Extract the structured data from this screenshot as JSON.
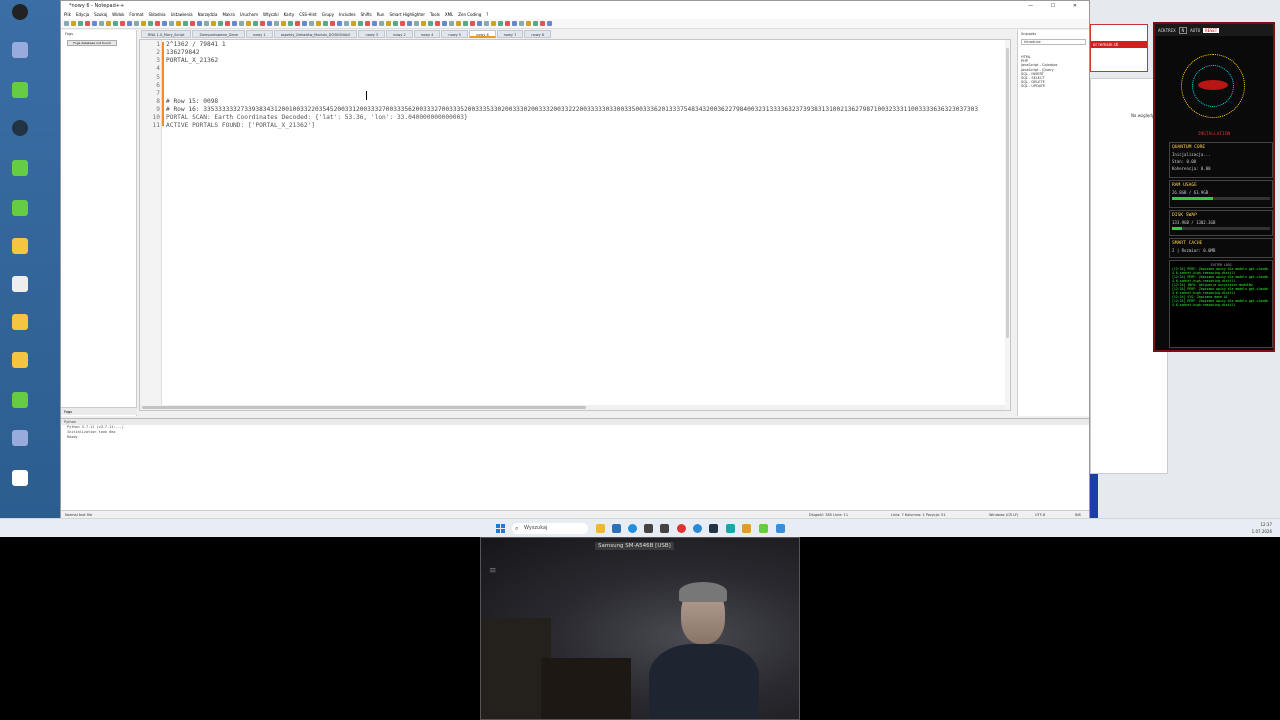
{
  "editor": {
    "title": "*nowy 6 - Notepad++",
    "window_controls": "— ☐ ✕",
    "menu": [
      "Plik",
      "Edycja",
      "Szukaj",
      "Widok",
      "Format",
      "Składnia",
      "Ustawienia",
      "Narzędzia",
      "Makra",
      "Uruchom",
      "Wtyczki",
      "Karty",
      "CSS-Hint",
      "Grupy",
      "Includes",
      "Shifts",
      "Run",
      "Smart Highlighter",
      "Tools",
      "XML",
      "Zen Coding",
      "?"
    ],
    "tabs": [
      {
        "label": "RNA 1.0_Mary_Script",
        "active": false
      },
      {
        "label": "Zaimportowane_Dane",
        "active": false
      },
      {
        "label": "nowy 1",
        "active": false
      },
      {
        "label": "aspekty_Dekadów_Modułu_DOSKONAŁE",
        "active": false
      },
      {
        "label": "nowy 3",
        "active": false
      },
      {
        "label": "nowy 2",
        "active": false
      },
      {
        "label": "nowy 4",
        "active": false
      },
      {
        "label": "nowy 5",
        "active": false
      },
      {
        "label": "nowy 6",
        "active": true
      },
      {
        "label": "nowy 7",
        "active": false
      },
      {
        "label": "nowy 8",
        "active": false
      }
    ],
    "left_panel": {
      "title": "Fogs",
      "button": "Fogs database not found"
    },
    "left_tabs": "Fogs",
    "code_lines": [
      "2^1362 / 79841 1",
      "136279842",
      "PORTAL_X_21362",
      "",
      "",
      "",
      "",
      "# Row 15: 0098",
      "# Row 16: 3353333332733938343120010033220354520033120033327003335620033327003335200333533020033302003332003322200333330330033500333620133375483432003622798400323133336323739383131002136279871003233311003333636323037303",
      "PORTAL SCAN: Earth Coordinates Decoded: {'lat': 53.36, 'lon': 33.040000000000003}",
      "ACTIVE PORTALS FOUND: ['PORTAL_X_21362']"
    ],
    "right_panel": {
      "title": "Snippets",
      "search": "Introduce",
      "items": [
        "HTML",
        "PHP",
        "JavaScript - Colorbox",
        "JavaScript - jQuery",
        "SQL - INSERT",
        "SQL - SELECT",
        "SQL - DELETE",
        "SQL - UPDATE"
      ]
    },
    "output": {
      "title": "Python",
      "lines": [
        "Python 3.7.11 (v3.7.11:...)",
        "Initialization took 0ms",
        "Ready"
      ]
    },
    "status": {
      "type": "Normal text file",
      "length": "Długość: 380   Linie: 11",
      "position": "Linia: 7   Kolumna: 1   Pozycja: 51",
      "eol": "Windows (CR LF)",
      "encoding": "UTF-8",
      "mode": "INS"
    }
  },
  "app2": {
    "header_warning": "or remain sti",
    "side_text": "Na względy"
  },
  "monitor": {
    "header": {
      "badge": "ACKTRIX",
      "mode": "AUTO",
      "field": "N",
      "reset": "RESET"
    },
    "stabilization_label": "INSTALLATION",
    "quantum": {
      "title": "QUANTUM CORE",
      "lines": [
        "Inicjalizacja...",
        "Stan: 0.00",
        "Koherencja: 0.00"
      ]
    },
    "ram": {
      "title": "RAM USAGE",
      "value": "26.8GB / 63.9GB",
      "fraction": 0.42
    },
    "swap": {
      "title": "DISK SWAP",
      "value": "133.9GB / 1302.3GB",
      "fraction": 0.1
    },
    "cache": {
      "title": "SMART CACHE",
      "value": "2 | Rozmiar: 0.0MB"
    },
    "logs_title": "SYSTEM LOGS",
    "logs": [
      "[12:34] PERF: Zapisano wpisy dla modelu gpt-claude-4.6-sonnet-high-reasoning-distill",
      "[12:34] PERF: Zapisano wpisy dla modelu gpt-claude-4.6-sonnet-high-reasoning-distill",
      "[12:34] INFO: Aktywacja wszystkich modułów",
      "[12:34] PERF: Zapisano wpisy dla modelu gpt-claude-4.6-sonnet-high-reasoning-distill",
      "[12:34] SYS: Zapisano dane AI",
      "[12:34] PERF: Zapisano wpisy dla modelu gpt-claude-4.6-sonnet-high-reasoning-distill"
    ]
  },
  "taskbar": {
    "search_placeholder": "Wyszukaj",
    "time": "12:37",
    "date": "1.07.2026"
  },
  "webcam": {
    "device_label": "Samsung SM-A546B [USB]"
  }
}
